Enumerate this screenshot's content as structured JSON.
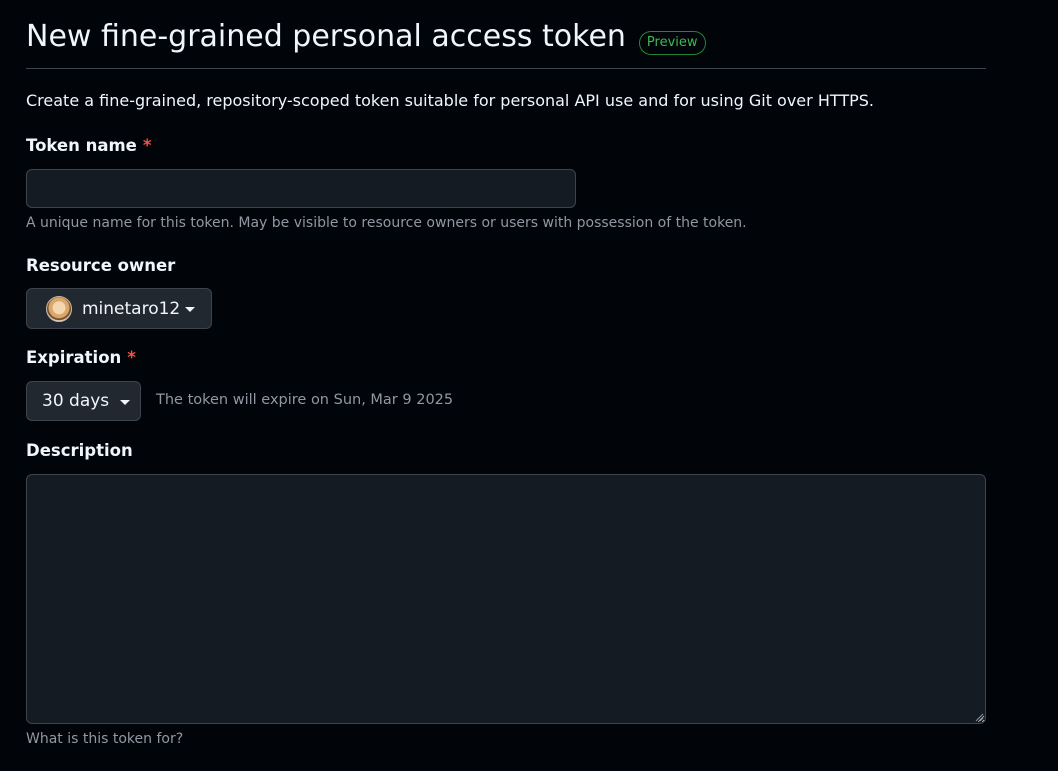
{
  "header": {
    "title": "New fine-grained personal access token",
    "badge": "Preview"
  },
  "intro": "Create a fine-grained, repository-scoped token suitable for personal API use and for using Git over HTTPS.",
  "token_name": {
    "label": "Token name",
    "required_mark": "*",
    "value": "",
    "placeholder": "",
    "hint": "A unique name for this token. May be visible to resource owners or users with possession of the token."
  },
  "resource_owner": {
    "label": "Resource owner",
    "selected": "minetaro12",
    "icon": "caret-down-icon"
  },
  "expiration": {
    "label": "Expiration",
    "required_mark": "*",
    "selected": "30 days",
    "note": "The token will expire on Sun, Mar 9 2025",
    "icon": "caret-down-icon"
  },
  "description": {
    "label": "Description",
    "value": "",
    "hint": "What is this token for?"
  },
  "colors": {
    "background": "#010409",
    "input_background": "#151b23",
    "border": "#3d444d",
    "text": "#f0f6fc",
    "muted": "#9198a1",
    "required": "#f85149",
    "badge": "#3fb950"
  }
}
